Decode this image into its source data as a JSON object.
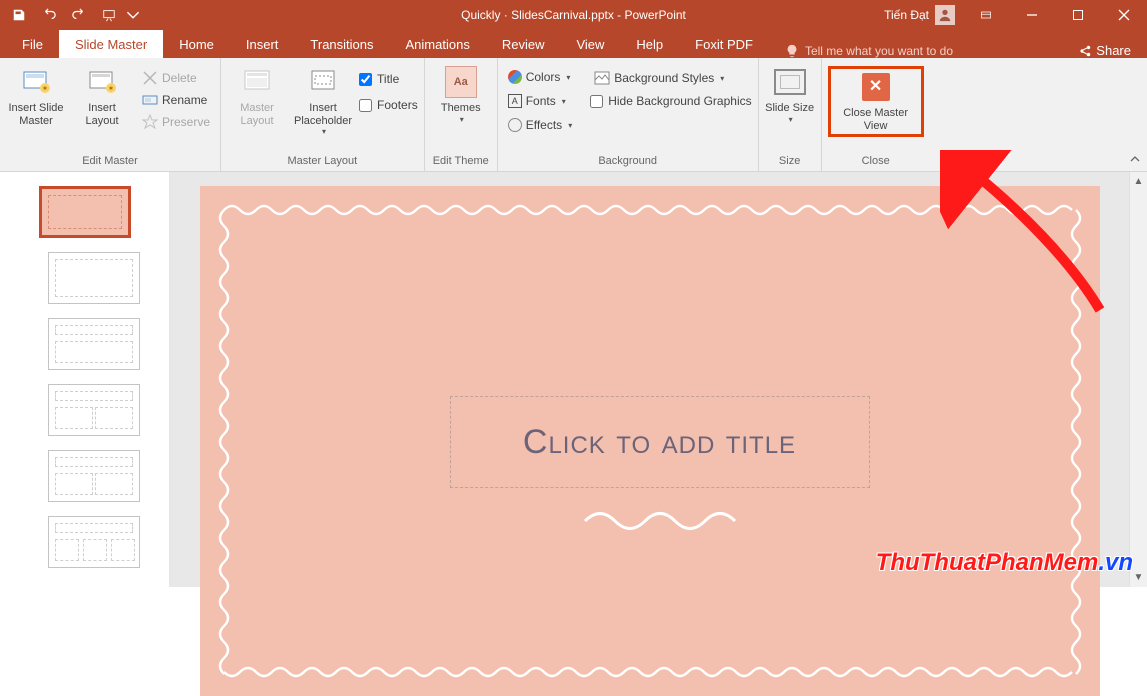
{
  "title": "Quickly · SlidesCarnival.pptx - PowerPoint",
  "user": {
    "name": "Tiến Đạt"
  },
  "share": "Share",
  "tabs": {
    "file": "File",
    "slide_master": "Slide Master",
    "home": "Home",
    "insert": "Insert",
    "transitions": "Transitions",
    "animations": "Animations",
    "review": "Review",
    "view": "View",
    "help": "Help",
    "foxit": "Foxit PDF"
  },
  "tellme": "Tell me what you want to do",
  "ribbon": {
    "edit_master": {
      "label": "Edit Master",
      "insert_slide_master": "Insert Slide Master",
      "insert_layout": "Insert Layout",
      "delete": "Delete",
      "rename": "Rename",
      "preserve": "Preserve"
    },
    "master_layout": {
      "label": "Master Layout",
      "master_layout_btn": "Master Layout",
      "insert_placeholder": "Insert Placeholder",
      "title": "Title",
      "footers": "Footers"
    },
    "edit_theme": {
      "label": "Edit Theme",
      "themes": "Themes"
    },
    "background": {
      "label": "Background",
      "colors": "Colors",
      "fonts": "Fonts",
      "effects": "Effects",
      "bg_styles": "Background Styles",
      "hide_bg": "Hide Background Graphics"
    },
    "size": {
      "label": "Size",
      "slide_size": "Slide Size"
    },
    "close": {
      "label": "Close",
      "close_master": "Close Master View"
    }
  },
  "slide": {
    "title_placeholder": "Click to add title"
  },
  "watermark": {
    "main": "ThuThuatPhanMem",
    "suffix": ".vn"
  }
}
